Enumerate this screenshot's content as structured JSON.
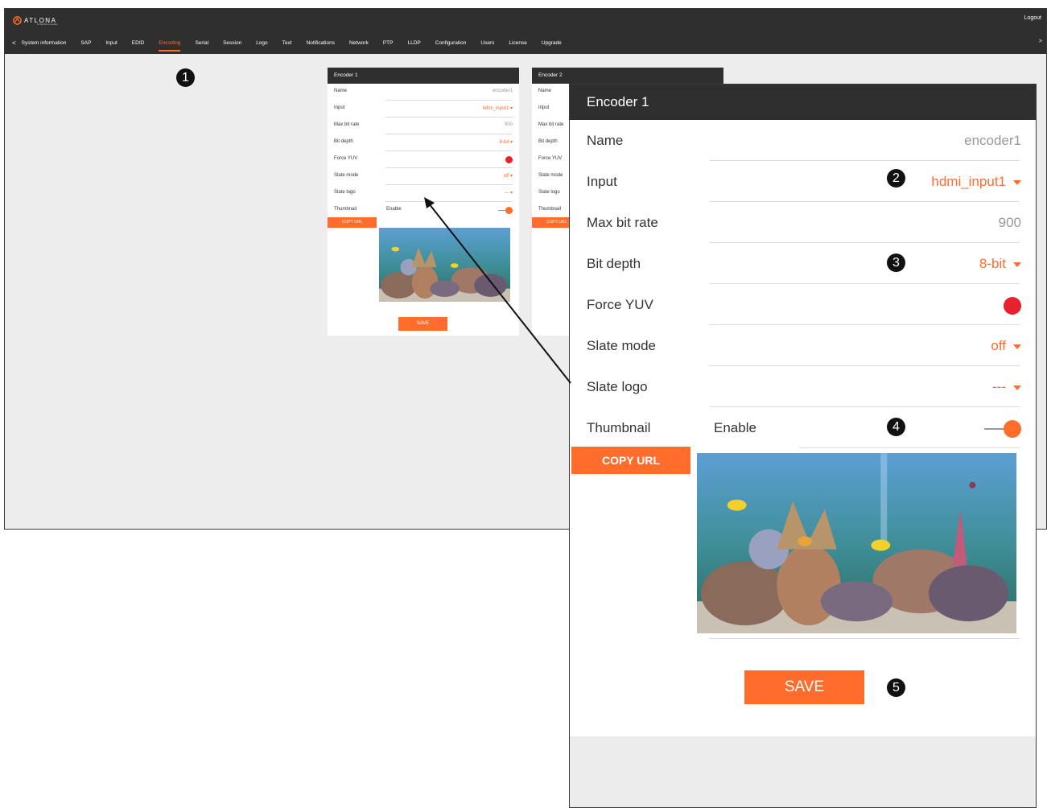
{
  "topbar": {
    "brand": "ATLONA",
    "brand_sub": "A Panduit company",
    "logout_label": "Logout",
    "nav_prev": "<",
    "nav_next": ">",
    "nav_items": [
      "System information",
      "SAP",
      "Input",
      "EDID",
      "Encoding",
      "Serial",
      "Session",
      "Logo",
      "Text",
      "Notifications",
      "Network",
      "PTP",
      "LLDP",
      "Configuration",
      "Users",
      "License",
      "Upgrade"
    ],
    "active_item": "Encoding"
  },
  "encoder1": {
    "title": "Encoder 1",
    "rows": [
      {
        "label": "Name",
        "value": "encoder1"
      },
      {
        "label": "Input",
        "value": "hdmi_input1"
      },
      {
        "label": "Max bit rate",
        "value": "900"
      },
      {
        "label": "Bit depth",
        "value": "8-bit"
      },
      {
        "label": "Force YUV",
        "value": ""
      },
      {
        "label": "Slate mode",
        "value": "off"
      },
      {
        "label": "Slate logo",
        "value": "---"
      },
      {
        "label": "Thumbnail",
        "value": "Enable"
      }
    ],
    "copy_url_label": "COPY URL",
    "save_label": "SAVE",
    "force_yuv_color": "#e8222c",
    "thumbnail_enabled": true
  },
  "encoder2": {
    "title": "Encoder 2",
    "labels": [
      "Name",
      "Input",
      "Max bit rate",
      "Bit depth",
      "Force YUV",
      "Slate mode",
      "Slate logo",
      "Thumbnail"
    ],
    "copy_url_label": "COPY URL"
  },
  "callouts": [
    "1",
    "2",
    "3",
    "4",
    "5"
  ],
  "colors": {
    "accent": "#ff6c2c",
    "header": "#2f2f2f",
    "force_yuv": "#e8222c"
  }
}
